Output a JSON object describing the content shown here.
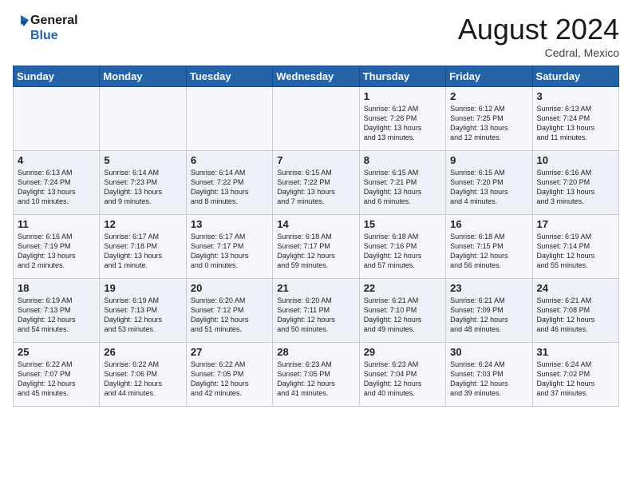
{
  "header": {
    "logo_line1": "General",
    "logo_line2": "Blue",
    "month_year": "August 2024",
    "location": "Cedral, Mexico"
  },
  "days_of_week": [
    "Sunday",
    "Monday",
    "Tuesday",
    "Wednesday",
    "Thursday",
    "Friday",
    "Saturday"
  ],
  "weeks": [
    [
      {
        "day": "",
        "info": ""
      },
      {
        "day": "",
        "info": ""
      },
      {
        "day": "",
        "info": ""
      },
      {
        "day": "",
        "info": ""
      },
      {
        "day": "1",
        "info": "Sunrise: 6:12 AM\nSunset: 7:26 PM\nDaylight: 13 hours\nand 13 minutes."
      },
      {
        "day": "2",
        "info": "Sunrise: 6:12 AM\nSunset: 7:25 PM\nDaylight: 13 hours\nand 12 minutes."
      },
      {
        "day": "3",
        "info": "Sunrise: 6:13 AM\nSunset: 7:24 PM\nDaylight: 13 hours\nand 11 minutes."
      }
    ],
    [
      {
        "day": "4",
        "info": "Sunrise: 6:13 AM\nSunset: 7:24 PM\nDaylight: 13 hours\nand 10 minutes."
      },
      {
        "day": "5",
        "info": "Sunrise: 6:14 AM\nSunset: 7:23 PM\nDaylight: 13 hours\nand 9 minutes."
      },
      {
        "day": "6",
        "info": "Sunrise: 6:14 AM\nSunset: 7:22 PM\nDaylight: 13 hours\nand 8 minutes."
      },
      {
        "day": "7",
        "info": "Sunrise: 6:15 AM\nSunset: 7:22 PM\nDaylight: 13 hours\nand 7 minutes."
      },
      {
        "day": "8",
        "info": "Sunrise: 6:15 AM\nSunset: 7:21 PM\nDaylight: 13 hours\nand 6 minutes."
      },
      {
        "day": "9",
        "info": "Sunrise: 6:15 AM\nSunset: 7:20 PM\nDaylight: 13 hours\nand 4 minutes."
      },
      {
        "day": "10",
        "info": "Sunrise: 6:16 AM\nSunset: 7:20 PM\nDaylight: 13 hours\nand 3 minutes."
      }
    ],
    [
      {
        "day": "11",
        "info": "Sunrise: 6:16 AM\nSunset: 7:19 PM\nDaylight: 13 hours\nand 2 minutes."
      },
      {
        "day": "12",
        "info": "Sunrise: 6:17 AM\nSunset: 7:18 PM\nDaylight: 13 hours\nand 1 minute."
      },
      {
        "day": "13",
        "info": "Sunrise: 6:17 AM\nSunset: 7:17 PM\nDaylight: 13 hours\nand 0 minutes."
      },
      {
        "day": "14",
        "info": "Sunrise: 6:18 AM\nSunset: 7:17 PM\nDaylight: 12 hours\nand 59 minutes."
      },
      {
        "day": "15",
        "info": "Sunrise: 6:18 AM\nSunset: 7:16 PM\nDaylight: 12 hours\nand 57 minutes."
      },
      {
        "day": "16",
        "info": "Sunrise: 6:18 AM\nSunset: 7:15 PM\nDaylight: 12 hours\nand 56 minutes."
      },
      {
        "day": "17",
        "info": "Sunrise: 6:19 AM\nSunset: 7:14 PM\nDaylight: 12 hours\nand 55 minutes."
      }
    ],
    [
      {
        "day": "18",
        "info": "Sunrise: 6:19 AM\nSunset: 7:13 PM\nDaylight: 12 hours\nand 54 minutes."
      },
      {
        "day": "19",
        "info": "Sunrise: 6:19 AM\nSunset: 7:13 PM\nDaylight: 12 hours\nand 53 minutes."
      },
      {
        "day": "20",
        "info": "Sunrise: 6:20 AM\nSunset: 7:12 PM\nDaylight: 12 hours\nand 51 minutes."
      },
      {
        "day": "21",
        "info": "Sunrise: 6:20 AM\nSunset: 7:11 PM\nDaylight: 12 hours\nand 50 minutes."
      },
      {
        "day": "22",
        "info": "Sunrise: 6:21 AM\nSunset: 7:10 PM\nDaylight: 12 hours\nand 49 minutes."
      },
      {
        "day": "23",
        "info": "Sunrise: 6:21 AM\nSunset: 7:09 PM\nDaylight: 12 hours\nand 48 minutes."
      },
      {
        "day": "24",
        "info": "Sunrise: 6:21 AM\nSunset: 7:08 PM\nDaylight: 12 hours\nand 46 minutes."
      }
    ],
    [
      {
        "day": "25",
        "info": "Sunrise: 6:22 AM\nSunset: 7:07 PM\nDaylight: 12 hours\nand 45 minutes."
      },
      {
        "day": "26",
        "info": "Sunrise: 6:22 AM\nSunset: 7:06 PM\nDaylight: 12 hours\nand 44 minutes."
      },
      {
        "day": "27",
        "info": "Sunrise: 6:22 AM\nSunset: 7:05 PM\nDaylight: 12 hours\nand 42 minutes."
      },
      {
        "day": "28",
        "info": "Sunrise: 6:23 AM\nSunset: 7:05 PM\nDaylight: 12 hours\nand 41 minutes."
      },
      {
        "day": "29",
        "info": "Sunrise: 6:23 AM\nSunset: 7:04 PM\nDaylight: 12 hours\nand 40 minutes."
      },
      {
        "day": "30",
        "info": "Sunrise: 6:24 AM\nSunset: 7:03 PM\nDaylight: 12 hours\nand 39 minutes."
      },
      {
        "day": "31",
        "info": "Sunrise: 6:24 AM\nSunset: 7:02 PM\nDaylight: 12 hours\nand 37 minutes."
      }
    ]
  ]
}
